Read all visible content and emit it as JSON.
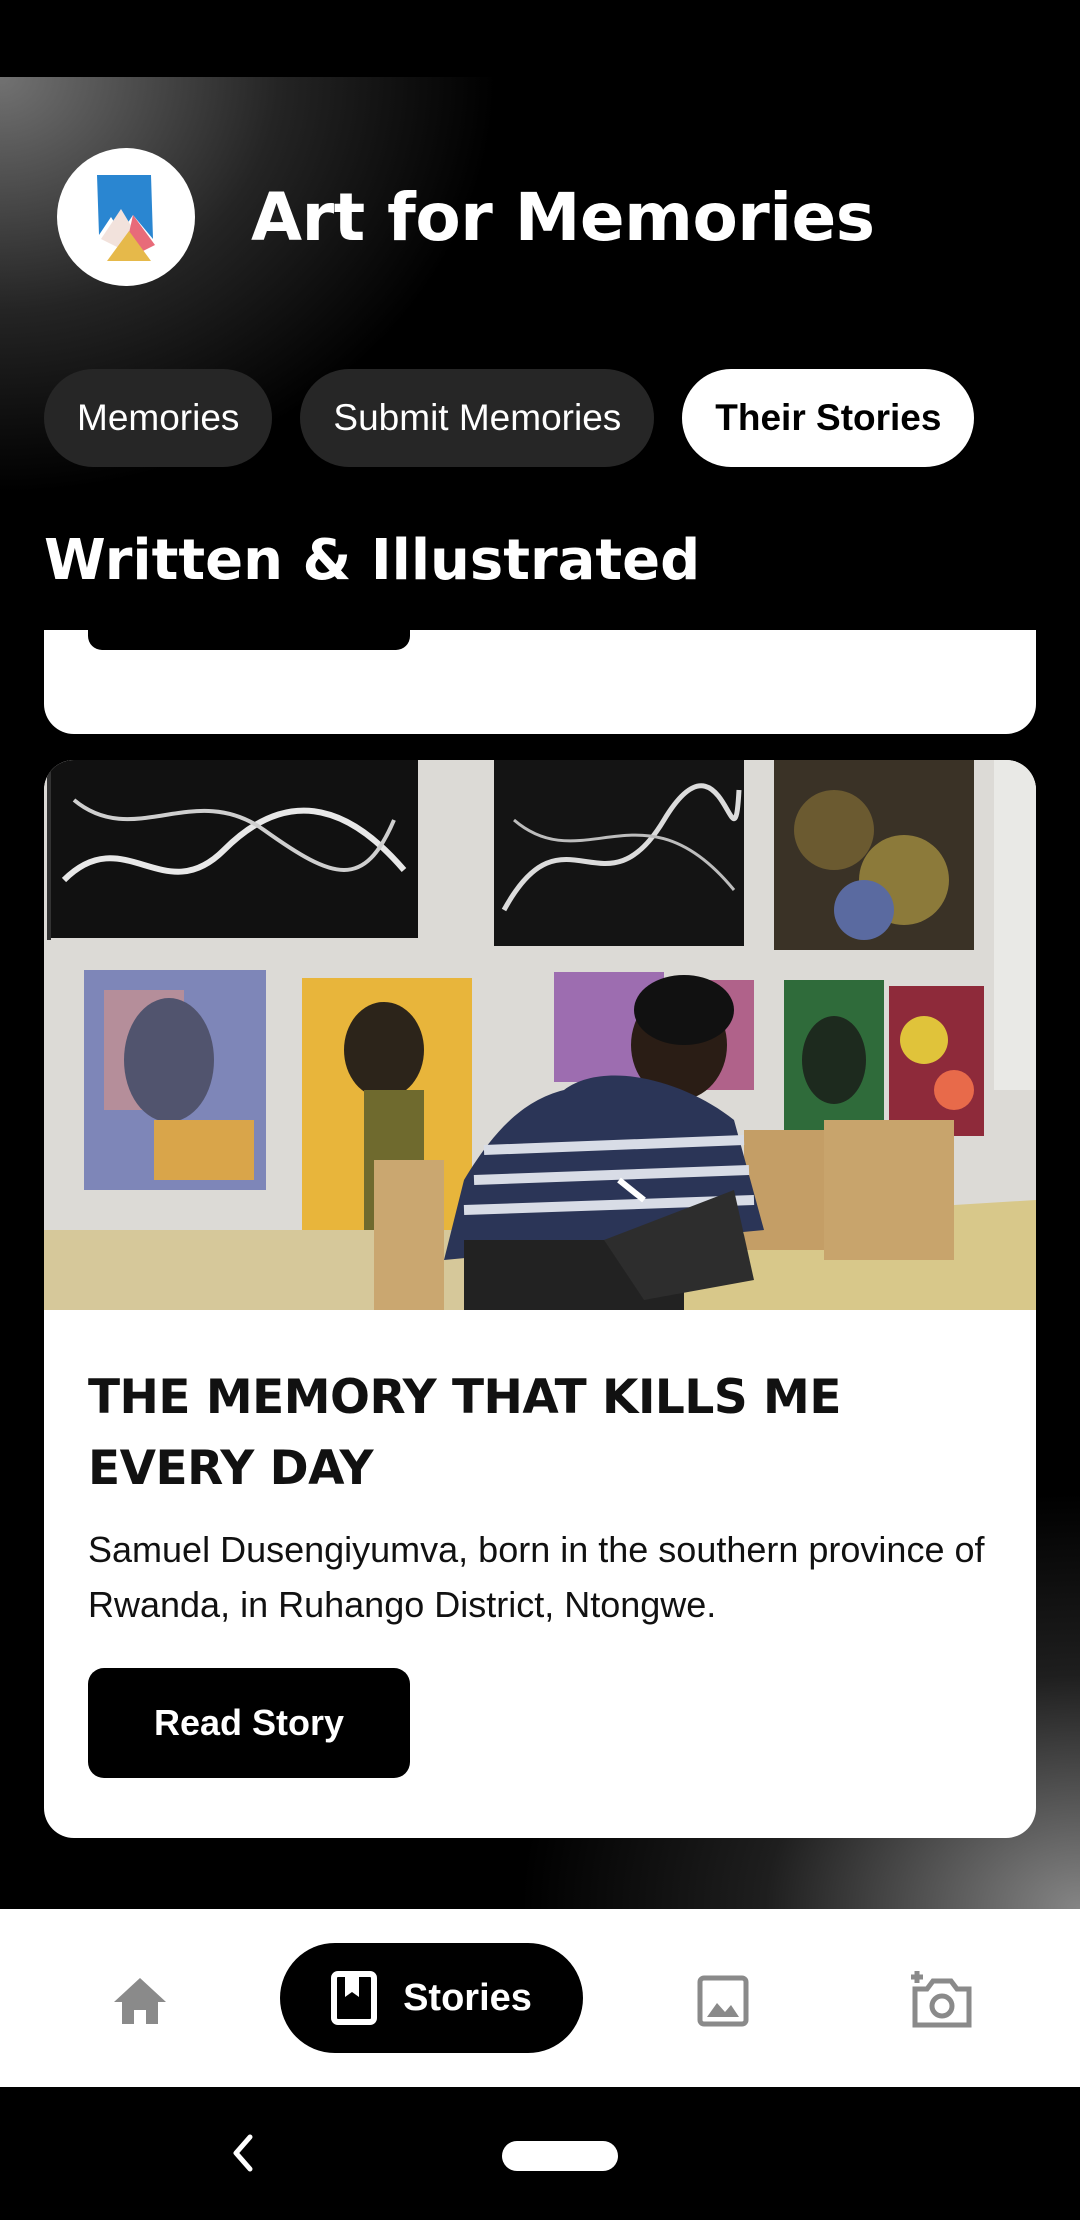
{
  "app": {
    "title": "Art for Memories"
  },
  "tabs": [
    {
      "label": "Memories",
      "active": false
    },
    {
      "label": "Submit Memories",
      "active": false
    },
    {
      "label": "Their Stories",
      "active": true
    }
  ],
  "section": {
    "title": "Written & Illustrated"
  },
  "story_card": {
    "title": "THE MEMORY THAT KILLS ME EVERY DAY",
    "description": "Samuel Dusengiyumva, born in the southern province of Rwanda, in Ruhango District, Ntongwe.",
    "button_label": "Read Story",
    "image": "photo-artist-drawing-on-tablet-in-studio"
  },
  "bottom_nav": {
    "items": [
      {
        "icon": "home-icon",
        "label": ""
      },
      {
        "icon": "book-icon",
        "label": "Stories",
        "active": true
      },
      {
        "icon": "image-icon",
        "label": ""
      },
      {
        "icon": "add-photo-icon",
        "label": ""
      }
    ]
  },
  "colors": {
    "accent": "#000000",
    "surface": "#ffffff",
    "tab_inactive": "#262626",
    "icon_inactive": "#8a8a8a"
  }
}
